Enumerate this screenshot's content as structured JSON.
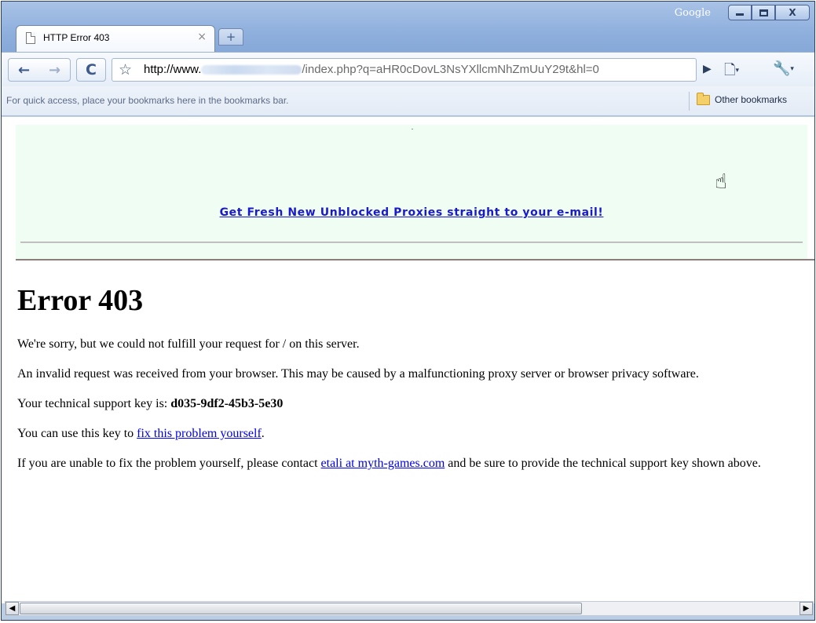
{
  "window": {
    "title_brand": "Google",
    "controls": {
      "minimize": "–",
      "maximize": "□",
      "close": "X"
    }
  },
  "tab": {
    "title": "HTTP Error 403",
    "close": "×",
    "new_tab": "+"
  },
  "toolbar": {
    "back": "←",
    "forward": "→",
    "reload": "C",
    "star": "☆",
    "url_host": "http://www.",
    "url_path": "/index.php?q=aHR0cDovL3NsYXllcmNhZmUuY29t&hl=0",
    "go": "▶",
    "page_menu": "🗋",
    "wrench_menu": "🔧",
    "dropdown": "▾"
  },
  "bookmarks": {
    "hint": "For quick access, place your bookmarks here in the bookmarks bar.",
    "other": "Other bookmarks"
  },
  "ad": {
    "link": "Get Fresh New Unblocked Proxies straight to your e-mail!"
  },
  "page": {
    "heading": "Error 403",
    "p1": "We're sorry, but we could not fulfill your request for / on this server.",
    "p2": "An invalid request was received from your browser. This may be caused by a malfunctioning proxy server or browser privacy software.",
    "p3_prefix": "Your technical support key is: ",
    "support_key": "d035-9df2-45b3-5e30",
    "p4_prefix": "You can use this key to ",
    "p4_link": "fix this problem yourself",
    "p4_suffix": ".",
    "p5_prefix": "If you are unable to fix the problem yourself, please contact ",
    "p5_link": "etali at myth-games.com",
    "p5_suffix": " and be sure to provide the technical support key shown above."
  },
  "scrollbar": {
    "left": "◀",
    "right": "▶"
  }
}
